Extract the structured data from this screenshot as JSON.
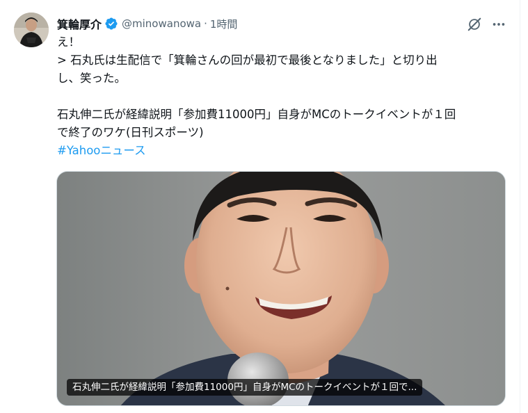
{
  "author": {
    "name": "箕輪厚介",
    "handle": "@minowanowa",
    "separator": "·",
    "time": "1時間",
    "verified": true,
    "verified_color": "#1d9bf0"
  },
  "actions": {
    "grok_icon": "grok-icon",
    "more_icon": "more-icon"
  },
  "tweet": {
    "lines": [
      "え！",
      "> 石丸氏は生配信で「箕輪さんの回が最初で最後となりました」と切り出",
      "し、笑った。",
      "",
      "石丸伸二氏が経緯説明「参加費11000円」自身がMCのトークイベントが１回",
      "で終了のワケ(日刊スポーツ)"
    ],
    "hashtag": "#Yahooニュース"
  },
  "card": {
    "caption": "石丸伸二氏が経緯説明「参加費11000円」自身がMCのトークイベントが１回で..."
  },
  "colors": {
    "text": "#0f1419",
    "secondary": "#536471",
    "link": "#1d9bf0"
  }
}
